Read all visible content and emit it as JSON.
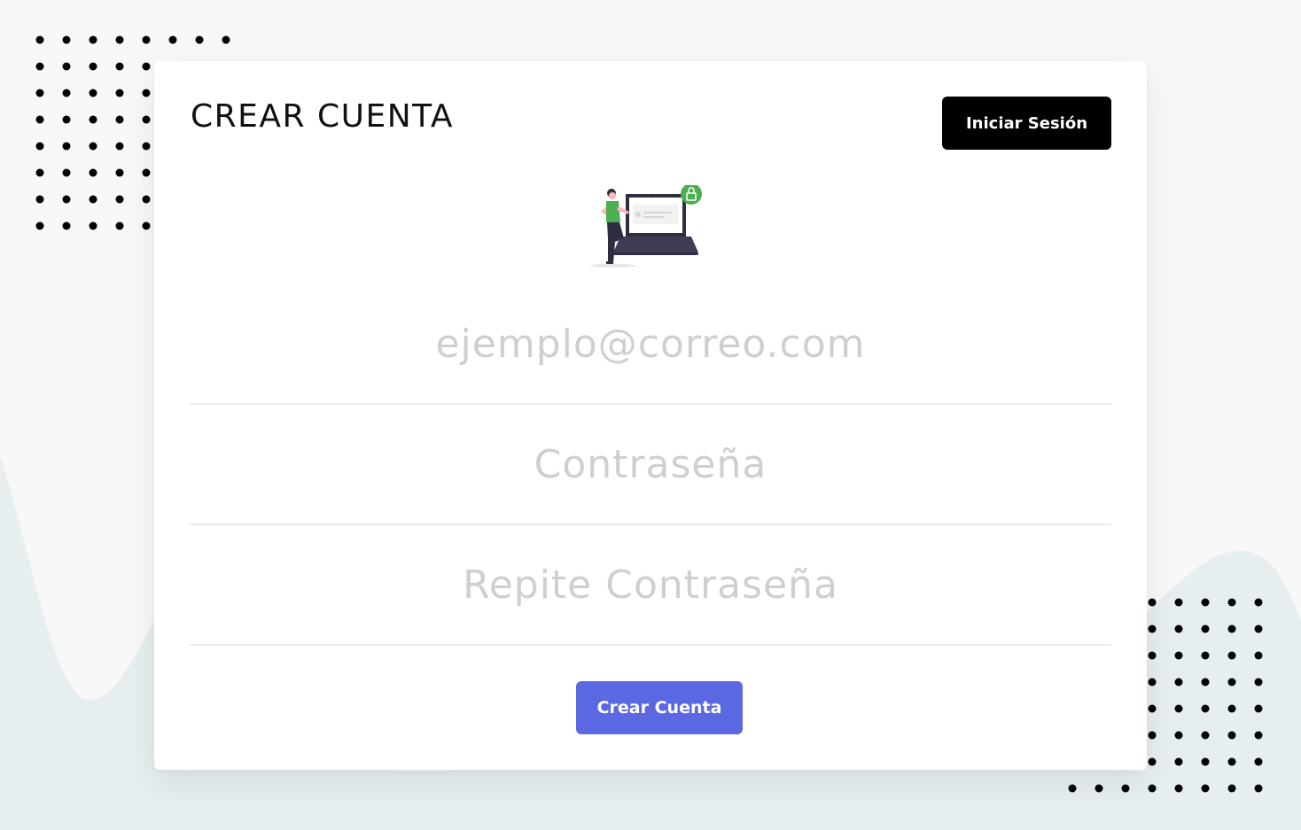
{
  "page": {
    "title": "CREAR CUENTA",
    "login_button": "Iniciar Sesión",
    "create_button": "Crear Cuenta"
  },
  "form": {
    "email_placeholder": "ejemplo@correo.com",
    "password_placeholder": "Contraseña",
    "repeat_password_placeholder": "Repite Contraseña",
    "email_value": "",
    "password_value": "",
    "repeat_password_value": ""
  },
  "illustration": {
    "icon": "woman-with-laptop-lock-illustration",
    "lock_icon": "lock-icon"
  },
  "colors": {
    "background": "#f8f8f8",
    "wave": "#e7eef0",
    "card": "#ffffff",
    "primary": "#5c67e2",
    "login_button": "#000000",
    "placeholder": "#cfcfcf",
    "divider": "#ececec",
    "lock_badge": "#4caf50"
  }
}
